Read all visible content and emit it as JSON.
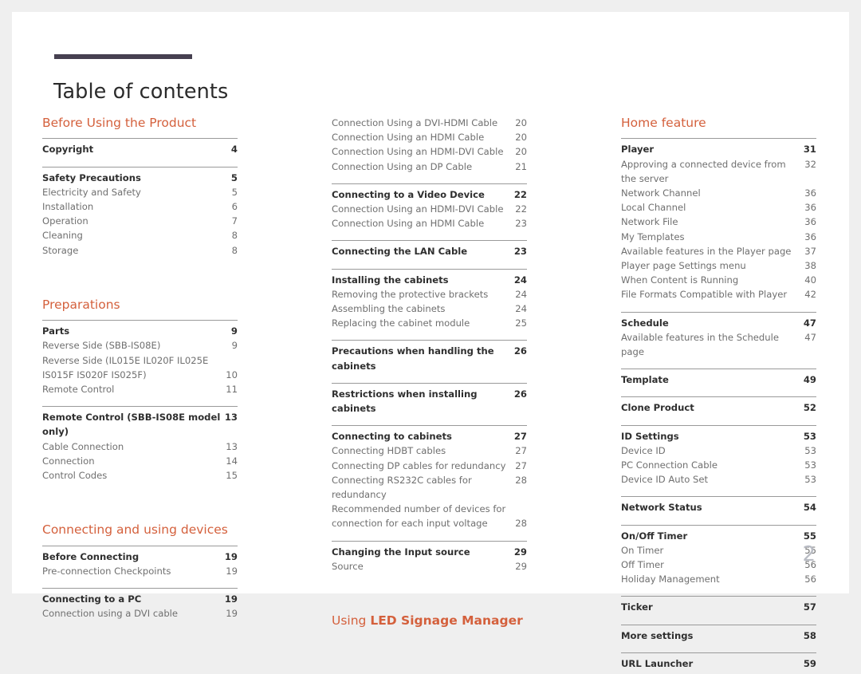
{
  "document": {
    "title": "Table of contents",
    "folio": "2",
    "accent_color": "#d4603c",
    "rule_color": "#464050"
  },
  "columns": [
    {
      "id": "column-1",
      "blocks": [
        {
          "type": "section",
          "heading": "Before Using the Product",
          "heading_plain": "Before Using the Product",
          "groups": [
            {
              "rows": [
                {
                  "label": "Copyright",
                  "page": "4",
                  "head": true
                }
              ]
            },
            {
              "rows": [
                {
                  "label": "Safety Precautions",
                  "page": "5",
                  "head": true
                },
                {
                  "label": "Electricity and Safety",
                  "page": "5",
                  "head": false
                },
                {
                  "label": "Installation",
                  "page": "6",
                  "head": false
                },
                {
                  "label": "Operation",
                  "page": "7",
                  "head": false
                },
                {
                  "label": "Cleaning",
                  "page": "8",
                  "head": false
                },
                {
                  "label": "Storage",
                  "page": "8",
                  "head": false
                }
              ]
            }
          ]
        },
        {
          "type": "section",
          "heading": "Preparations",
          "heading_plain": "Preparations",
          "groups": [
            {
              "rows": [
                {
                  "label": "Parts",
                  "page": "9",
                  "head": true
                },
                {
                  "label": "Reverse Side (SBB-IS08E)",
                  "page": "9",
                  "head": false
                },
                {
                  "label": "Reverse Side (IL015E IL020F IL025E IS015F IS020F IS025F)",
                  "page": "10",
                  "head": false,
                  "multiline": true
                },
                {
                  "label": "Remote Control",
                  "page": "11",
                  "head": false
                }
              ]
            },
            {
              "rows": [
                {
                  "label": "Remote Control (SBB-IS08E model only)",
                  "page": "13",
                  "head": true,
                  "tight": true
                },
                {
                  "label": "Cable Connection",
                  "page": "13",
                  "head": false
                },
                {
                  "label": "Connection",
                  "page": "14",
                  "head": false
                },
                {
                  "label": "Control Codes",
                  "page": "15",
                  "head": false
                }
              ]
            }
          ]
        },
        {
          "type": "section",
          "heading": "Connecting and using devices",
          "heading_plain": "Connecting and using devices",
          "groups": [
            {
              "rows": [
                {
                  "label": "Before Connecting",
                  "page": "19",
                  "head": true
                },
                {
                  "label": "Pre-connection Checkpoints",
                  "page": "19",
                  "head": false
                }
              ]
            },
            {
              "rows": [
                {
                  "label": "Connecting to a PC",
                  "page": "19",
                  "head": true
                },
                {
                  "label": "Connection using a DVI cable",
                  "page": "19",
                  "head": false
                }
              ]
            }
          ]
        }
      ]
    },
    {
      "id": "column-2",
      "blocks": [
        {
          "type": "rows",
          "groups": [
            {
              "no_rule": true,
              "rows": [
                {
                  "label": "Connection Using a DVI-HDMI Cable",
                  "page": "20",
                  "head": false
                },
                {
                  "label": "Connection Using an HDMI Cable",
                  "page": "20",
                  "head": false
                },
                {
                  "label": "Connection Using an HDMI-DVI Cable",
                  "page": "20",
                  "head": false
                },
                {
                  "label": "Connection Using an DP Cable",
                  "page": "21",
                  "head": false
                }
              ]
            },
            {
              "rows": [
                {
                  "label": "Connecting to a Video Device",
                  "page": "22",
                  "head": true
                },
                {
                  "label": "Connection Using an HDMI-DVI Cable",
                  "page": "22",
                  "head": false
                },
                {
                  "label": "Connection Using an HDMI Cable",
                  "page": "23",
                  "head": false
                }
              ]
            },
            {
              "rows": [
                {
                  "label": "Connecting the LAN Cable",
                  "page": "23",
                  "head": true
                }
              ]
            },
            {
              "rows": [
                {
                  "label": "Installing the cabinets",
                  "page": "24",
                  "head": true
                },
                {
                  "label": "Removing the protective brackets",
                  "page": "24",
                  "head": false
                },
                {
                  "label": "Assembling the cabinets",
                  "page": "24",
                  "head": false
                },
                {
                  "label": "Replacing the cabinet module",
                  "page": "25",
                  "head": false
                }
              ]
            },
            {
              "rows": [
                {
                  "label": "Precautions when handling the cabinets",
                  "page": "26",
                  "head": true,
                  "tight": true
                }
              ]
            },
            {
              "rows": [
                {
                  "label": "Restrictions when installing cabinets",
                  "page": "26",
                  "head": true
                }
              ]
            },
            {
              "rows": [
                {
                  "label": "Connecting to cabinets",
                  "page": "27",
                  "head": true
                },
                {
                  "label": "Connecting HDBT cables",
                  "page": "27",
                  "head": false
                },
                {
                  "label": "Connecting DP cables for redundancy",
                  "page": "27",
                  "head": false
                },
                {
                  "label": "Connecting RS232C cables for redundancy",
                  "page": "28",
                  "head": false,
                  "tight": true
                },
                {
                  "label": "Recommended number of devices for connection for each input voltage",
                  "page": "28",
                  "head": false,
                  "multiline": true
                }
              ]
            },
            {
              "rows": [
                {
                  "label": "Changing the Input source",
                  "page": "29",
                  "head": true
                },
                {
                  "label": "Source",
                  "page": "29",
                  "head": false
                }
              ]
            }
          ]
        },
        {
          "type": "section",
          "heading": "Using LED Signage Manager",
          "heading_light": "Using ",
          "heading_strong": "LED Signage Manager",
          "groups": []
        }
      ]
    },
    {
      "id": "column-3",
      "blocks": [
        {
          "type": "section",
          "heading": "Home feature",
          "heading_plain": "Home feature",
          "groups": [
            {
              "rows": [
                {
                  "label": "Player",
                  "page": "31",
                  "head": true
                },
                {
                  "label": "Approving a connected device from the server",
                  "page": "32",
                  "head": false,
                  "tight": true
                },
                {
                  "label": "Network Channel",
                  "page": "36",
                  "head": false
                },
                {
                  "label": "Local Channel",
                  "page": "36",
                  "head": false
                },
                {
                  "label": "Network File",
                  "page": "36",
                  "head": false
                },
                {
                  "label": "My Templates",
                  "page": "36",
                  "head": false
                },
                {
                  "label": "Available features in the Player page",
                  "page": "37",
                  "head": false
                },
                {
                  "label": "Player page Settings menu",
                  "page": "38",
                  "head": false
                },
                {
                  "label": "When Content is Running",
                  "page": "40",
                  "head": false
                },
                {
                  "label": "File Formats Compatible with Player",
                  "page": "42",
                  "head": false
                }
              ]
            },
            {
              "rows": [
                {
                  "label": "Schedule",
                  "page": "47",
                  "head": true
                },
                {
                  "label": "Available features in the Schedule page",
                  "page": "47",
                  "head": false
                }
              ]
            },
            {
              "rows": [
                {
                  "label": "Template",
                  "page": "49",
                  "head": true
                }
              ]
            },
            {
              "rows": [
                {
                  "label": "Clone Product",
                  "page": "52",
                  "head": true
                }
              ]
            },
            {
              "rows": [
                {
                  "label": "ID Settings",
                  "page": "53",
                  "head": true
                },
                {
                  "label": "Device ID",
                  "page": "53",
                  "head": false
                },
                {
                  "label": "PC Connection Cable",
                  "page": "53",
                  "head": false
                },
                {
                  "label": "Device ID Auto Set",
                  "page": "53",
                  "head": false
                }
              ]
            },
            {
              "rows": [
                {
                  "label": "Network Status",
                  "page": "54",
                  "head": true
                }
              ]
            },
            {
              "rows": [
                {
                  "label": "On/Off Timer",
                  "page": "55",
                  "head": true
                },
                {
                  "label": "On Timer",
                  "page": "55",
                  "head": false
                },
                {
                  "label": "Off Timer",
                  "page": "56",
                  "head": false
                },
                {
                  "label": "Holiday Management",
                  "page": "56",
                  "head": false
                }
              ]
            },
            {
              "rows": [
                {
                  "label": "Ticker",
                  "page": "57",
                  "head": true
                }
              ]
            },
            {
              "rows": [
                {
                  "label": "More settings",
                  "page": "58",
                  "head": true
                }
              ]
            },
            {
              "rows": [
                {
                  "label": "URL Launcher",
                  "page": "59",
                  "head": true
                }
              ]
            }
          ]
        }
      ]
    }
  ]
}
